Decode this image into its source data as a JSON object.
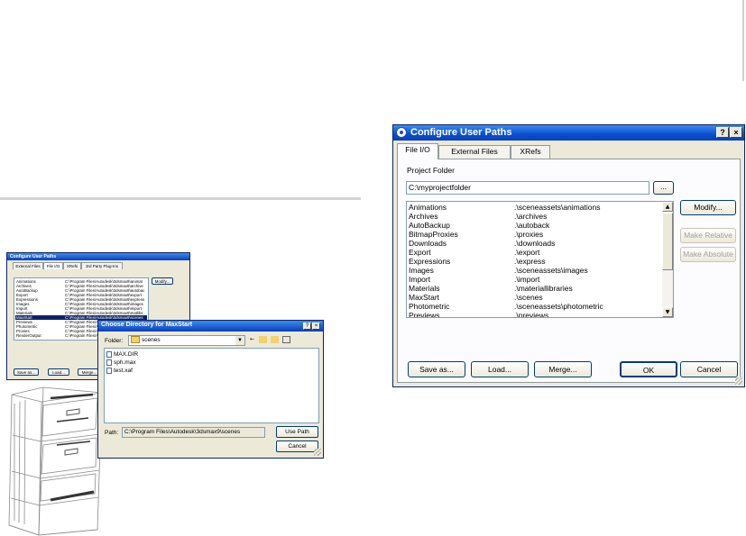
{
  "dialog": {
    "title": "Configure User Paths",
    "help_btn": "?",
    "close_btn": "×",
    "tabs": [
      "File I/O",
      "External Files",
      "XRefs"
    ],
    "project_folder_label": "Project Folder",
    "project_folder_value": "C:\\myprojectfolder",
    "browse_btn": "...",
    "paths": [
      {
        "name": "Animations",
        "path": ".\\sceneassets\\animations"
      },
      {
        "name": "Archives",
        "path": ".\\archives"
      },
      {
        "name": "AutoBackup",
        "path": ".\\autoback"
      },
      {
        "name": "BitmapProxies",
        "path": ".\\proxies"
      },
      {
        "name": "Downloads",
        "path": ".\\downloads"
      },
      {
        "name": "Export",
        "path": ".\\export"
      },
      {
        "name": "Expressions",
        "path": ".\\express"
      },
      {
        "name": "Images",
        "path": ".\\sceneassets\\images"
      },
      {
        "name": "Import",
        "path": ".\\import"
      },
      {
        "name": "Materials",
        "path": ".\\materiallibraries"
      },
      {
        "name": "MaxStart",
        "path": ".\\scenes"
      },
      {
        "name": "Photometric",
        "path": ".\\sceneassets\\photometric"
      },
      {
        "name": "Previews",
        "path": ".\\previews"
      }
    ],
    "modify_btn": "Modify...",
    "make_relative_btn": "Make Relative",
    "make_absolute_btn": "Make Absolute",
    "save_as_btn": "Save as...",
    "load_btn": "Load...",
    "merge_btn": "Merge...",
    "ok_btn": "OK",
    "cancel_btn": "Cancel"
  },
  "mini_dialog": {
    "title": "Configure User Paths",
    "tabs": [
      "External Files",
      "File I/O",
      "XRefs",
      "3rd Party Plug-Ins"
    ],
    "rows": [
      {
        "name": "Animations",
        "path": "C:\\Program Files\\Autodesk\\3dsmax9\\animat"
      },
      {
        "name": "Archives",
        "path": "C:\\Program Files\\Autodesk\\3dsmax9\\archive"
      },
      {
        "name": "AutoBackup",
        "path": "C:\\Program Files\\Autodesk\\3dsmax9\\autobac"
      },
      {
        "name": "Export",
        "path": "C:\\Program Files\\Autodesk\\3dsmax9\\export"
      },
      {
        "name": "Expressions",
        "path": "C:\\Program Files\\Autodesk\\3dsmax9\\express"
      },
      {
        "name": "Images",
        "path": "C:\\Program Files\\Autodesk\\3dsmax9\\images"
      },
      {
        "name": "Import",
        "path": "C:\\Program Files\\Autodesk\\3dsmax9\\import"
      },
      {
        "name": "Materials",
        "path": "C:\\Program Files\\Autodesk\\3dsmax9\\matlibs"
      },
      {
        "name": "MaxStart",
        "path": "C:\\Program Files\\Autodesk\\3dsmax9\\scenes"
      },
      {
        "name": "Previews",
        "path": "C:\\Program Files\\Au"
      },
      {
        "name": "Photometric",
        "path": "C:\\Program Files\\Au"
      },
      {
        "name": "Proxies",
        "path": "C:\\Program Files\\Au"
      },
      {
        "name": "RenderOutput",
        "path": "C:\\Program Files\\Au"
      },
      {
        "name": "RenderPresets",
        "path": "C:\\Program Files\\Au"
      }
    ],
    "selected_index": 8,
    "modify_btn": "Modify...",
    "save_as_btn": "Save as...",
    "load_btn": "Load...",
    "merge_btn": "Merge..."
  },
  "choose_dir": {
    "title": "Choose Directory for MaxStart",
    "help_btn": "?",
    "close_btn": "×",
    "folder_label": "Folder:",
    "folder_value": "scenes",
    "files": [
      "MAX.DIR",
      "sph.max",
      "test.xaf"
    ],
    "path_label": "Path:",
    "path_value": "C:\\Program Files\\Autodesk\\3dsmax9\\scenes",
    "use_path_btn": "Use Path",
    "cancel_btn": "Cancel"
  }
}
